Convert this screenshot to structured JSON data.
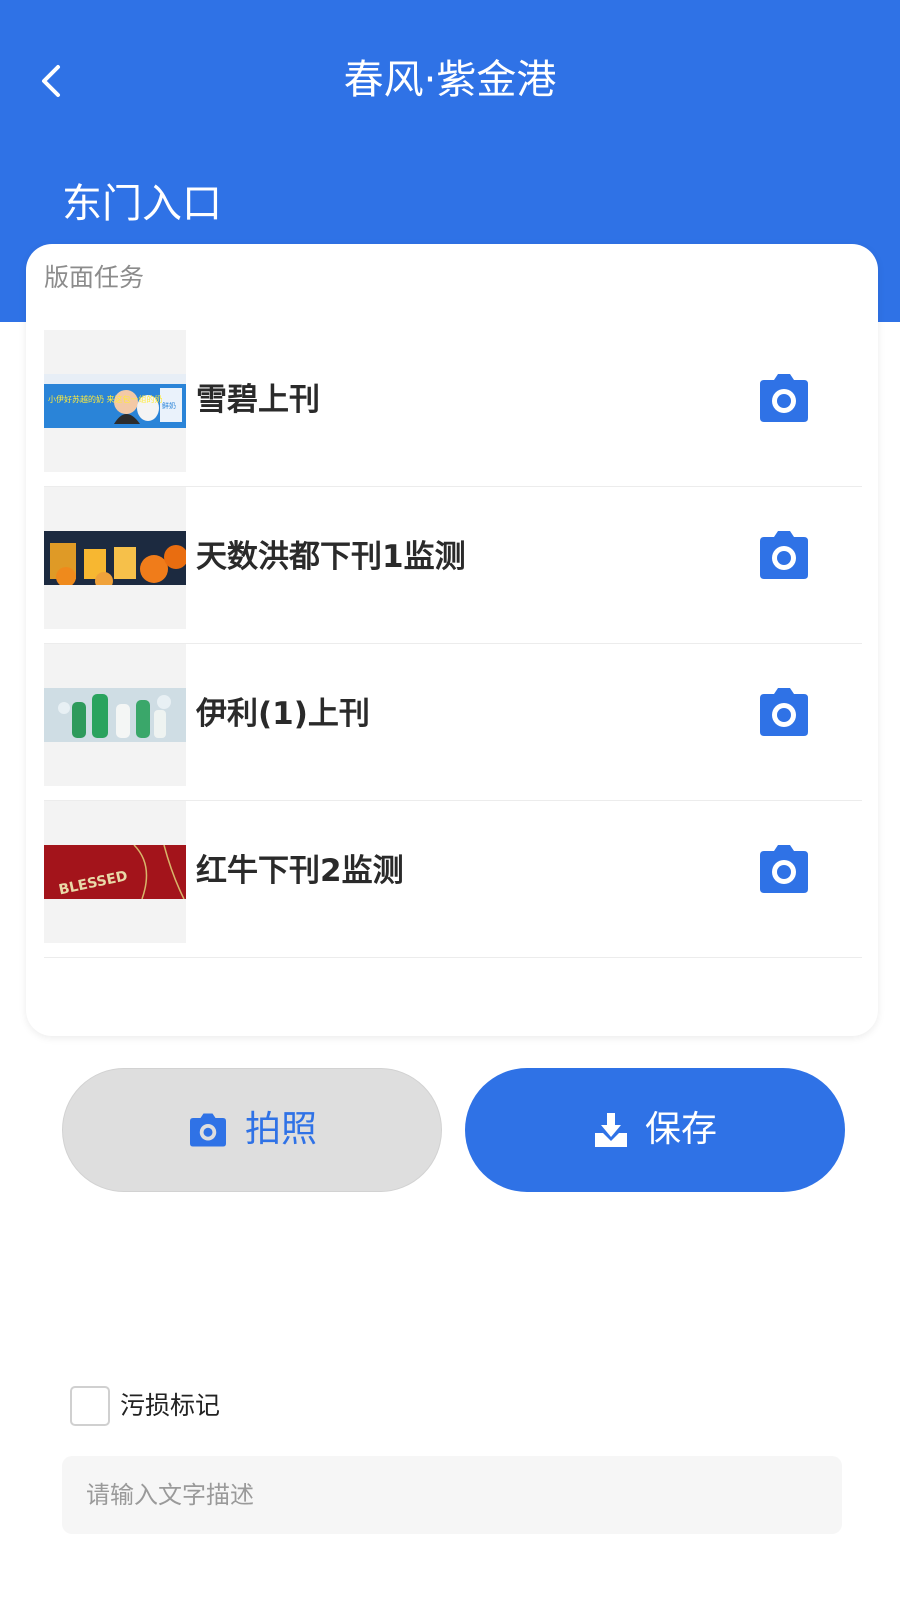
{
  "header": {
    "title": "春风·紫金港",
    "location": "东门入口",
    "back_icon": "chevron-left-icon"
  },
  "tasks_card": {
    "title": "版面任务",
    "items": [
      {
        "name": "雪碧上刊",
        "thumb_text": "小伊好苏越的奶 来这包一组的奶",
        "thumb_badge": "鲜奶"
      },
      {
        "name": "天数洪都下刊1监测"
      },
      {
        "name": "伊利(1)上刊"
      },
      {
        "name": "红牛下刊2监测",
        "thumb_text": "BLESSED"
      }
    ],
    "camera_icon": "camera-icon"
  },
  "actions": {
    "photo_label": "拍照",
    "photo_icon": "camera-icon",
    "save_label": "保存",
    "save_icon": "download-tray-icon"
  },
  "damage": {
    "label": "污损标记",
    "checked": false
  },
  "description": {
    "placeholder": "请输入文字描述",
    "value": ""
  },
  "colors": {
    "primary": "#2f72e6",
    "background": "#ffffff"
  }
}
